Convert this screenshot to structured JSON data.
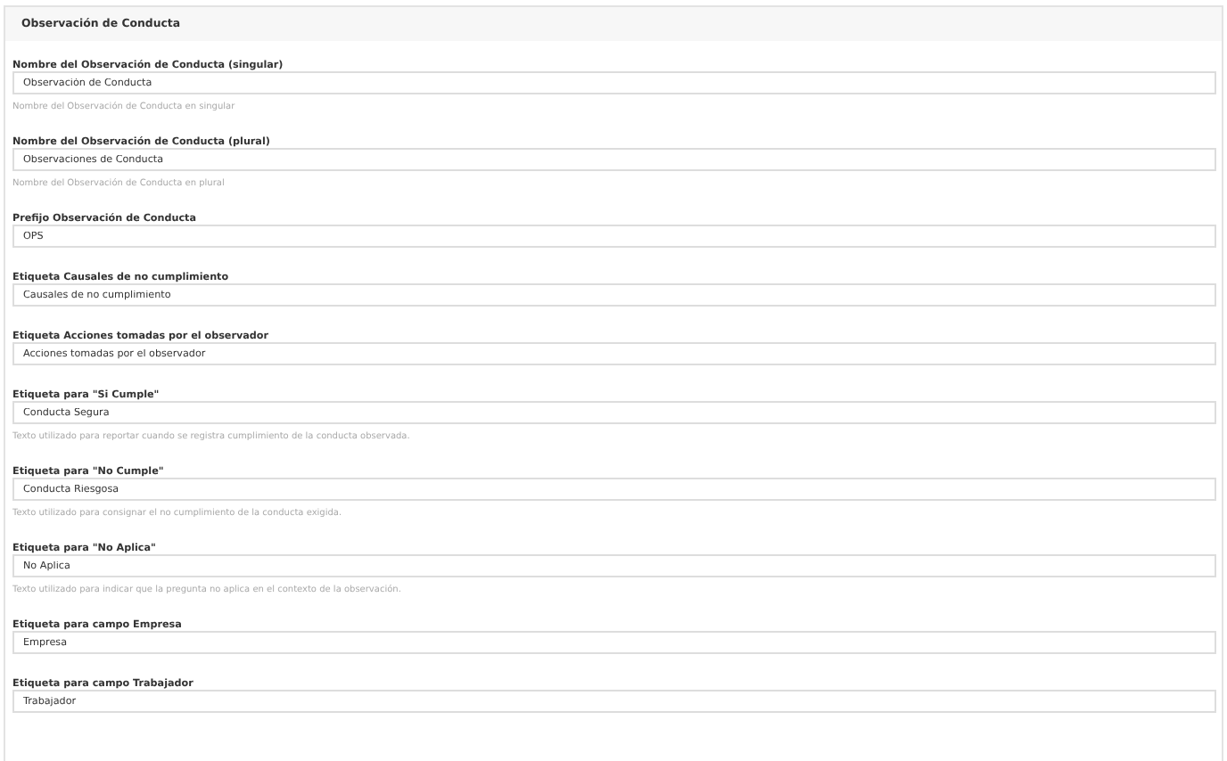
{
  "panel": {
    "title": "Observación de Conducta",
    "fields": [
      {
        "label": "Nombre del Observación de Conducta (singular)",
        "value": "Observación de Conducta",
        "help": "Nombre del Observación de Conducta en singular"
      },
      {
        "label": "Nombre del Observación de Conducta (plural)",
        "value": "Observaciones de Conducta",
        "help": "Nombre del Observación de Conducta en plural"
      },
      {
        "label": "Prefijo Observación de Conducta",
        "value": "OPS"
      },
      {
        "label": "Etiqueta Causales de no cumplimiento",
        "value": "Causales de no cumplimiento"
      },
      {
        "label": "Etiqueta Acciones tomadas por el observador",
        "value": "Acciones tomadas por el observador"
      },
      {
        "label": "Etiqueta para \"Si Cumple\"",
        "value": "Conducta Segura",
        "help": "Texto utilizado para reportar cuando se registra cumplimiento de la conducta observada."
      },
      {
        "label": "Etiqueta para \"No Cumple\"",
        "value": "Conducta Riesgosa",
        "help": "Texto utilizado para consignar el no cumplimiento de la conducta exigida."
      },
      {
        "label": "Etiqueta para \"No Aplica\"",
        "value": "No Aplica",
        "help": "Texto utilizado para indicar que la pregunta no aplica en el contexto de la observación."
      },
      {
        "label": "Etiqueta para campo Empresa",
        "value": "Empresa"
      },
      {
        "label": "Etiqueta para campo Trabajador",
        "value": "Trabajador"
      }
    ]
  }
}
